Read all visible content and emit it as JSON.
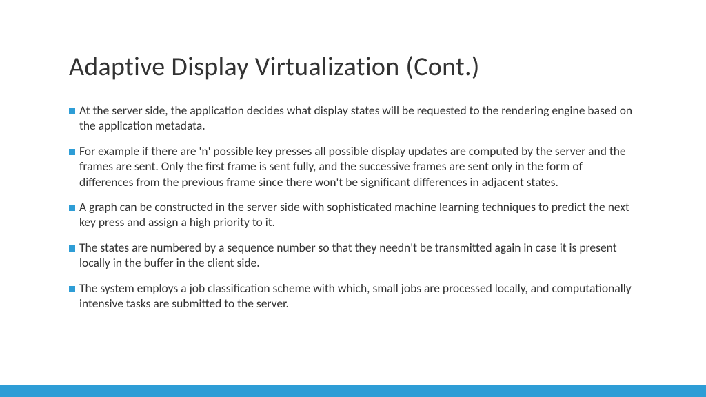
{
  "title": "Adaptive Display Virtualization (Cont.)",
  "bullets": [
    "At the server side, the application decides what display states will be requested to the rendering engine based on the application metadata.",
    "For example if there are 'n' possible key presses all possible display updates are computed by the server and the frames are sent. Only the first frame is sent fully, and the successive frames are sent only in the form of differences from the previous frame since there won't be significant differences in adjacent states.",
    "A graph can be constructed in the server side with sophisticated machine learning techniques to predict the next key press and assign a high priority to it.",
    "The states are numbered by a sequence number so that they needn't be transmitted again in case it is present locally in the buffer in the client side.",
    "The system employs a job classification scheme with which, small jobs are processed locally, and computationally intensive tasks are submitted to the server."
  ]
}
